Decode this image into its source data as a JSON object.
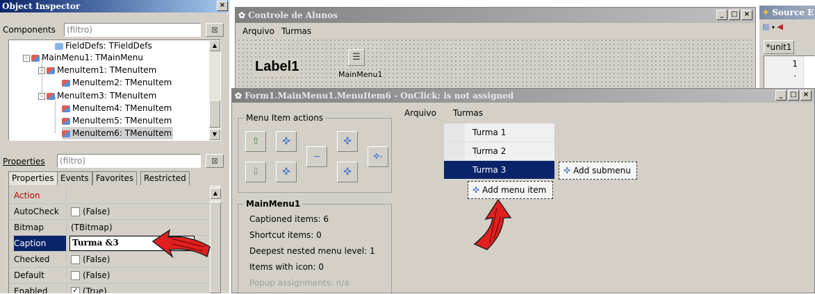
{
  "object_inspector": {
    "title": "Object Inspector",
    "components_label": "Components",
    "filter_placeholder": "(filtro)",
    "tree": [
      {
        "label": "FieldDefs: TFieldDefs",
        "level": 3
      },
      {
        "label": "MainMenu1: TMainMenu",
        "level": 2
      },
      {
        "label": "MenuItem1: TMenuItem",
        "level": 3
      },
      {
        "label": "MenuItem2: TMenuItem",
        "level": 4
      },
      {
        "label": "MenuItem3: TMenuItem",
        "level": 3
      },
      {
        "label": "MenuItem4: TMenuItem",
        "level": 4
      },
      {
        "label": "MenuItem5: TMenuItem",
        "level": 4
      },
      {
        "label": "MenuItem6: TMenuItem",
        "level": 4,
        "selected": true
      }
    ],
    "properties_label": "Properties",
    "properties_filter_placeholder": "(filtro)",
    "tabs": [
      "Properties",
      "Events",
      "Favorites",
      "Restricted"
    ],
    "props": [
      {
        "name": "Action",
        "value": "",
        "name_color": "#c00000"
      },
      {
        "name": "AutoCheck",
        "value": "(False)",
        "check": "unchecked"
      },
      {
        "name": "Bitmap",
        "value": "(TBitmap)"
      },
      {
        "name": "Caption",
        "value": "Turma &3",
        "selected": true
      },
      {
        "name": "Checked",
        "value": "(False)",
        "check": "unchecked"
      },
      {
        "name": "Default",
        "value": "(False)",
        "check": "unchecked"
      },
      {
        "name": "Enabled",
        "value": "(True)",
        "check": "checked"
      }
    ]
  },
  "form_window": {
    "title": "Controle de Alunos",
    "menu": [
      "Arquivo",
      "Turmas"
    ],
    "label": "Label1",
    "component_caption": "MainMenu1"
  },
  "source_window": {
    "title": "Source E",
    "tab": "*unit1",
    "line_number": "1"
  },
  "menu_editor": {
    "title": "Form1.MainMenu1.MenuItem6 - OnClick: is not assigned",
    "actions_title": "Menu Item actions",
    "info_title": "MainMenu1",
    "info": [
      "Captioned items: 6",
      "Shortcut items: 0",
      "Deepest nested menu level: 1",
      "Items with icon: 0",
      "Popup assignments: n/a"
    ],
    "menubar": [
      "Arquivo",
      "Turmas"
    ],
    "items": [
      "Turma 1",
      "Turma 2",
      "Turma 3"
    ],
    "selected_index": 2,
    "add_submenu": "Add submenu",
    "add_menu_item": "Add menu item"
  },
  "colors": {
    "selection": "#0a246a",
    "arrow": "#e02020"
  }
}
